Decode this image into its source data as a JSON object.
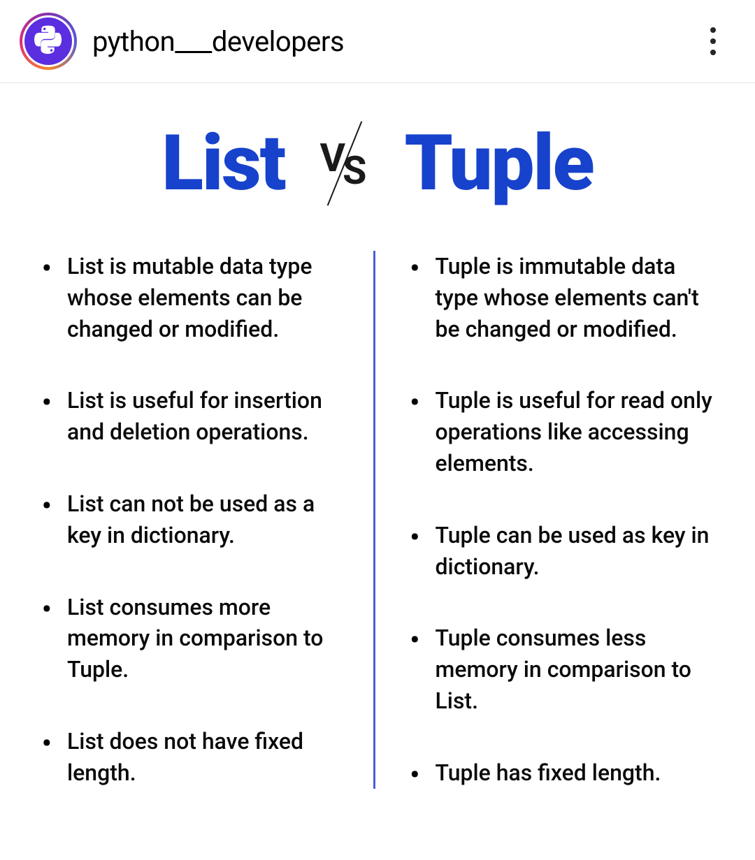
{
  "header": {
    "username": "python___developers"
  },
  "post": {
    "title_left": "List",
    "title_right": "Tuple",
    "vs_v": "V",
    "vs_s": "S",
    "list_points": [
      "List is mutable data type whose elements can be changed or modified.",
      "List is useful for insertion and deletion operations.",
      "List can not be used as  a key in dictionary.",
      "List consumes more memory in comparison to Tuple.",
      "List does not have fixed length."
    ],
    "tuple_points": [
      "Tuple is immutable data type whose elements can't be changed or modified.",
      "Tuple is useful for read only operations like accessing elements.",
      "Tuple can be used as key in dictionary.",
      "Tuple consumes less memory in comparison to List.",
      "Tuple has fixed length."
    ]
  }
}
